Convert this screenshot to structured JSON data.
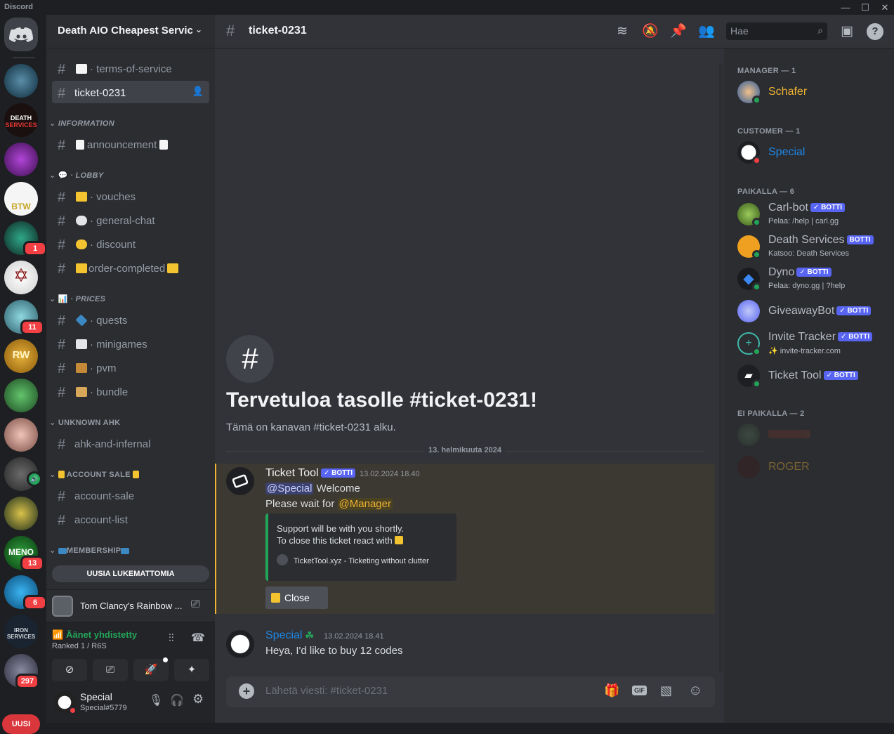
{
  "window": {
    "title": "Discord"
  },
  "servers": {
    "badges": {
      "b1": "1",
      "b2": "11",
      "b3": "13",
      "b4": "6",
      "b5": "297"
    },
    "new_label": "UUSI"
  },
  "guild": {
    "name": "Death AIO Cheapest Servic"
  },
  "channels": {
    "tos": "· terms-of-service",
    "ticket": "ticket-0231",
    "cat_information": "INFORMATION",
    "announcement": "announcement",
    "cat_lobby": "· LOBBY",
    "vouches": "· vouches",
    "general": "· general-chat",
    "discount": "· discount",
    "order": "order-completed",
    "cat_prices": "· PRICES",
    "quests": "· quests",
    "minigames": "· minigames",
    "pvm": "· pvm",
    "bundle": "· bundle",
    "cat_unknown": "UNKNOWN AHK",
    "ahk": "ahk-and-infernal",
    "cat_account": "ACCOUNT SALE",
    "account_sale": "account-sale",
    "account_list": "account-list",
    "cat_membership": "MEMBERSHIP",
    "unread": "UUSIA LUKEMATTOMIA"
  },
  "activity": {
    "game": "Tom Clancy's Rainbow ..."
  },
  "voice": {
    "status": "Äänet yhdistetty",
    "channel": "Ranked 1 / R6S"
  },
  "user": {
    "name": "Special",
    "tag": "Special#5779"
  },
  "topbar": {
    "channel": "ticket-0231",
    "search_placeholder": "Hae"
  },
  "welcome": {
    "title": "Tervetuloa tasolle #ticket-0231!",
    "subtitle": "Tämä on kanavan #ticket-0231 alku.",
    "date_divider": "13. helmikuuta 2024"
  },
  "messages": [
    {
      "author": "Ticket Tool",
      "badge": "BOTTI",
      "time": "13.02.2024 18.40",
      "mention1": "@Special",
      "text1": " Welcome",
      "text2": "Please wait for ",
      "mention2": "@Manager",
      "embed": {
        "line1": "Support will be with you shortly.",
        "line2": "To close this ticket react with",
        "footer": "TicketTool.xyz - Ticketing without clutter"
      },
      "button": "Close"
    },
    {
      "author": "Special",
      "time": "13.02.2024 18.41",
      "text": "Heya, I'd like to buy 12 codes"
    }
  ],
  "composer": {
    "placeholder": "Lähetä viesti: #ticket-0231"
  },
  "members": {
    "groups": {
      "manager": "MANAGER — 1",
      "customer": "CUSTOMER — 1",
      "online": "PAIKALLA — 6",
      "offline": "EI PAIKALLA — 2"
    },
    "list": [
      {
        "name": "Schafer"
      },
      {
        "name": "Special"
      },
      {
        "name": "Carl-bot",
        "badge": "BOTTI",
        "sub": "Pelaa: /help | carl.gg"
      },
      {
        "name": "Death Services",
        "badge": "BOTTI",
        "sub": "Katsoo: Death Services"
      },
      {
        "name": "Dyno",
        "badge": "BOTTI",
        "sub": "Pelaa: dyno.gg | ?help"
      },
      {
        "name": "GiveawayBot",
        "badge": "BOTTI"
      },
      {
        "name": "Invite Tracker",
        "badge": "BOTTI",
        "sub": "✨ invite-tracker.com"
      },
      {
        "name": "Ticket Tool",
        "badge": "BOTTI"
      },
      {
        "name": "ROGER"
      }
    ]
  },
  "colors": {
    "accent": "#5865f2",
    "online": "#23a559",
    "dnd": "#f23f43",
    "manager": "#f0b232",
    "customer": "#1e88e5"
  }
}
